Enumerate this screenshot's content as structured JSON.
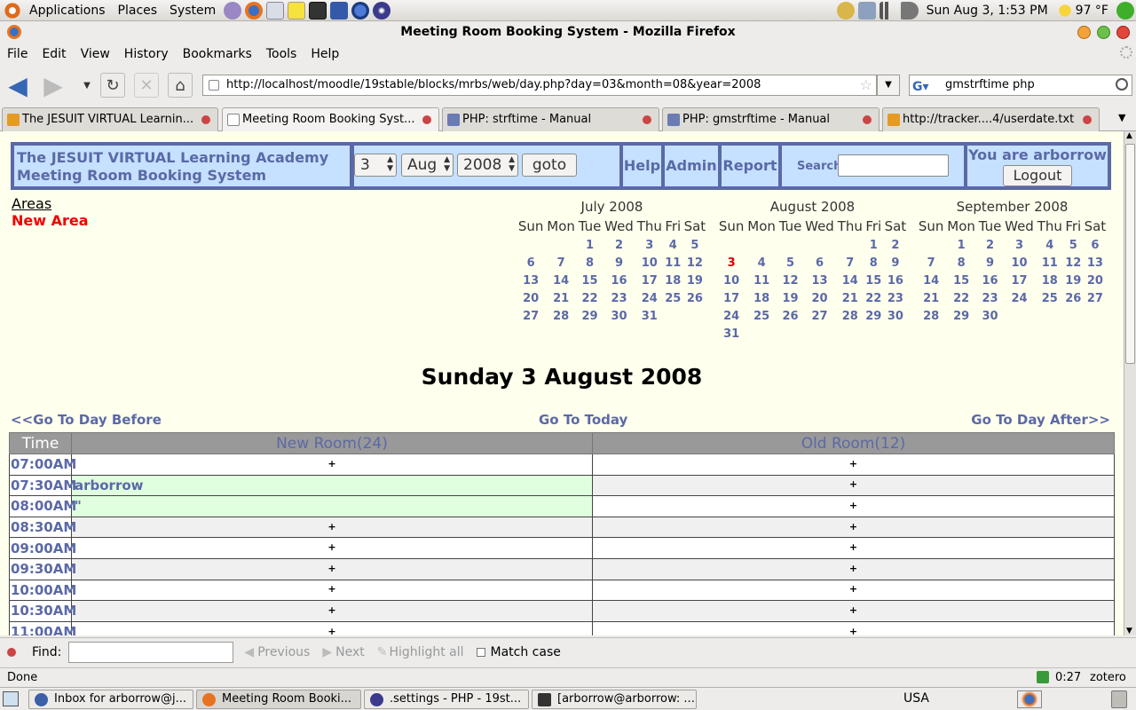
{
  "gnome": {
    "menus": [
      "Applications",
      "Places",
      "System"
    ],
    "clock": "Sun Aug  3,  1:53 PM",
    "weather": "97 °F"
  },
  "window": {
    "title": "Meeting Room Booking System - Mozilla Firefox"
  },
  "menubar": [
    "File",
    "Edit",
    "View",
    "History",
    "Bookmarks",
    "Tools",
    "Help"
  ],
  "nav": {
    "url": "http://localhost/moodle/19stable/blocks/mrbs/web/day.php?day=03&month=08&year=2008",
    "search_value": "gmstrftime php"
  },
  "tabs": [
    {
      "label": "The JESUIT VIRTUAL Learnin...",
      "icon": "moodle-icon"
    },
    {
      "label": "Meeting Room Booking Syst...",
      "icon": "page-icon"
    },
    {
      "label": "PHP: strftime - Manual",
      "icon": "php-icon"
    },
    {
      "label": "PHP: gmstrftime - Manual",
      "icon": "php-icon"
    },
    {
      "label": "http://tracker....4/userdate.txt",
      "icon": "moodle-icon"
    }
  ],
  "header": {
    "site_line1": "The JESUIT VIRTUAL Learning Academy",
    "site_line2": "Meeting Room Booking System",
    "day_value": "3",
    "month_value": "Aug",
    "year_value": "2008",
    "goto_label": "goto",
    "help": "Help",
    "admin": "Admin",
    "report": "Report",
    "search_label": "Search",
    "user_text": "You are arborrow",
    "logout": "Logout"
  },
  "areas": {
    "heading": "Areas",
    "new_area": "New Area"
  },
  "calendars": [
    {
      "title": "July 2008",
      "offset": 2,
      "days": 31,
      "today": 0
    },
    {
      "title": "August 2008",
      "offset": 5,
      "days": 31,
      "today": 3
    },
    {
      "title": "September 2008",
      "offset": 1,
      "days": 30,
      "today": 0
    }
  ],
  "weekdays": [
    "Sun",
    "Mon",
    "Tue",
    "Wed",
    "Thu",
    "Fri",
    "Sat"
  ],
  "day_title": "Sunday 3 August 2008",
  "day_nav": {
    "before": "<<Go To Day Before",
    "today": "Go To Today",
    "after": "Go To Day After>>"
  },
  "grid": {
    "time_header": "Time",
    "rooms": [
      "New Room(24)",
      "Old Room(12)"
    ],
    "rows": [
      {
        "time": "07:00AM",
        "cells": [
          "+",
          "+"
        ]
      },
      {
        "time": "07:30AM",
        "cells": [
          "arborrow",
          "+"
        ]
      },
      {
        "time": "08:00AM",
        "cells": [
          "\"",
          "+"
        ]
      },
      {
        "time": "08:30AM",
        "cells": [
          "+",
          "+"
        ]
      },
      {
        "time": "09:00AM",
        "cells": [
          "+",
          "+"
        ]
      },
      {
        "time": "09:30AM",
        "cells": [
          "+",
          "+"
        ]
      },
      {
        "time": "10:00AM",
        "cells": [
          "+",
          "+"
        ]
      },
      {
        "time": "10:30AM",
        "cells": [
          "+",
          "+"
        ]
      },
      {
        "time": "11:00AM",
        "cells": [
          "+",
          "+"
        ]
      }
    ]
  },
  "findbar": {
    "label": "Find:",
    "previous": "Previous",
    "next": "Next",
    "highlight": "Highlight all",
    "match_case": "Match case"
  },
  "status": {
    "text": "Done",
    "timer": "0:27",
    "zotero": "zotero"
  },
  "taskbar": {
    "tasks": [
      "Inbox for arborrow@j...",
      "Meeting Room Booki...",
      ".settings - PHP - 19st...",
      "[arborrow@arborrow: ..."
    ],
    "locale": "USA"
  }
}
